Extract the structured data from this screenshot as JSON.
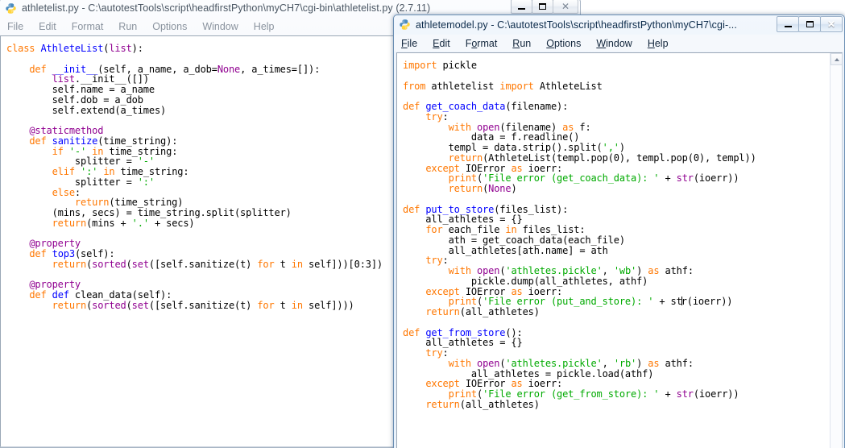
{
  "windows": [
    {
      "id": "athletelist",
      "state": "inactive",
      "title": "athletelist.py - C:\\autotestTools\\script\\headfirstPython\\myCH7\\cgi-bin\\athletelist.py (2.7.11)",
      "icon": "python-idle-icon",
      "menu": [
        "File",
        "Edit",
        "Format",
        "Run",
        "Options",
        "Window",
        "Help"
      ],
      "buttons": {
        "minimize": "minimize-button",
        "maximize": "maximize-button",
        "close": "close-button"
      },
      "code_lines": [
        "class AthleteList(list):",
        "",
        "    def __init__(self, a_name, a_dob=None, a_times=[]):",
        "        list.__init__([])",
        "        self.name = a_name",
        "        self.dob = a_dob",
        "        self.extend(a_times)",
        "",
        "    @staticmethod",
        "    def sanitize(time_string):",
        "        if '-' in time_string:",
        "            splitter = '-'",
        "        elif ':' in time_string:",
        "            splitter = ':'",
        "        else:",
        "            return(time_string)",
        "        (mins, secs) = time_string.split(splitter)",
        "        return(mins + '.' + secs)",
        "",
        "    @property",
        "    def top3(self):",
        "        return(sorted(set([self.sanitize(t) for t in self]))[0:3])",
        "",
        "    @property",
        "    def def clean_data(self):",
        "        return(sorted(set([self.sanitize(t) for t in self])))"
      ]
    },
    {
      "id": "athletemodel",
      "state": "active",
      "title": "athletemodel.py - C:\\autotestTools\\script\\headfirstPython\\myCH7\\cgi-...",
      "icon": "python-idle-icon",
      "menu": [
        "File",
        "Edit",
        "Format",
        "Run",
        "Options",
        "Window",
        "Help"
      ],
      "buttons": {
        "minimize": "minimize-button",
        "maximize": "maximize-button",
        "close": "close-button"
      },
      "code_lines": [
        "import pickle",
        "",
        "from athletelist import AthleteList",
        "",
        "def get_coach_data(filename):",
        "    try:",
        "        with open(filename) as f:",
        "            data = f.readline()",
        "        templ = data.strip().split(',')",
        "        return(AthleteList(templ.pop(0), templ.pop(0), templ))",
        "    except IOError as ioerr:",
        "        print('File error (get_coach_data): ' + str(ioerr))",
        "        return(None)",
        "",
        "def put_to_store(files_list):",
        "    all_athletes = {}",
        "    for each_file in files_list:",
        "        ath = get_coach_data(each_file)",
        "        all_athletes[ath.name] = ath",
        "    try:",
        "        with open('athletes.pickle', 'wb') as athf:",
        "            pickle.dump(all_athletes, athf)",
        "    except IOError as ioerr:",
        "        print('File error (put_and_store): ' + str(ioerr))",
        "    return(all_athletes)",
        "",
        "def get_from_store():",
        "    all_athletes = {}",
        "    try:",
        "        with open('athletes.pickle', 'rb') as athf:",
        "            all_athletes = pickle.load(athf)",
        "    except IOError as ioerr:",
        "        print('File error (get_from_store): ' + str(ioerr))",
        "    return(all_athletes)"
      ],
      "scrollbar": {
        "up_arrow": "scroll-up-arrow"
      }
    }
  ],
  "colors": {
    "keyword": "#ff7700",
    "definition": "#0000ff",
    "builtin": "#900090",
    "string": "#00aa00",
    "text": "#000000",
    "close_button": "#c83a25",
    "active_title_text": "#0b2a4a",
    "inactive_title_text": "#4a5663"
  }
}
